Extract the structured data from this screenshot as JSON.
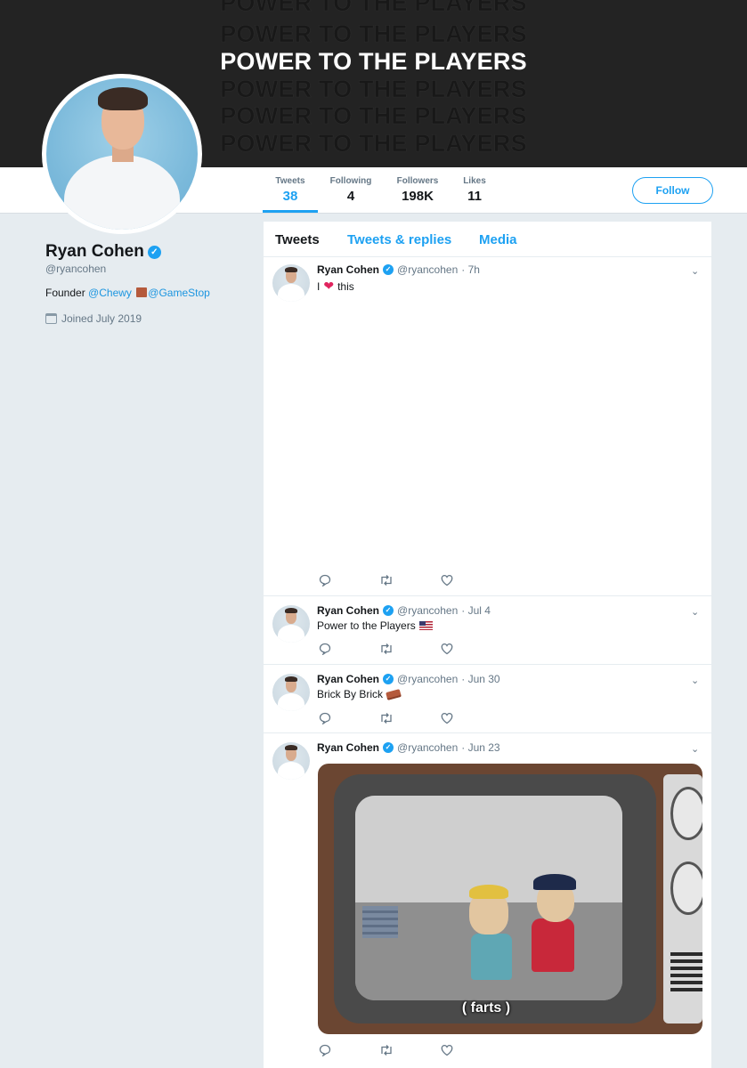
{
  "banner": {
    "lines": [
      "POWER TO THE PLAYERS",
      "POWER TO THE PLAYERS",
      "POWER TO THE PLAYERS",
      "POWER TO THE PLAYERS",
      "POWER TO THE PLAYERS",
      "POWER TO THE PLAYERS"
    ],
    "highlight_index": 2
  },
  "stats": [
    {
      "label": "Tweets",
      "value": "38"
    },
    {
      "label": "Following",
      "value": "4"
    },
    {
      "label": "Followers",
      "value": "198K"
    },
    {
      "label": "Likes",
      "value": "11"
    }
  ],
  "follow_label": "Follow",
  "profile": {
    "name": "Ryan Cohen",
    "handle": "@ryancohen",
    "bio_prefix": "Founder",
    "bio_link1": "@Chewy",
    "bio_link2": "@GameStop",
    "joined": "Joined July 2019"
  },
  "tabs": [
    "Tweets",
    "Tweets & replies",
    "Media"
  ],
  "tweets": [
    {
      "name": "Ryan Cohen",
      "handle": "@ryancohen",
      "time": "· 7h",
      "text_a": "I",
      "text_b": "this",
      "emoji": "heart"
    },
    {
      "name": "Ryan Cohen",
      "handle": "@ryancohen",
      "time": "· Jul 4",
      "text_a": "Power to the Players",
      "emoji": "us-flag"
    },
    {
      "name": "Ryan Cohen",
      "handle": "@ryancohen",
      "time": "· Jun 30",
      "text_a": "Brick By Brick",
      "emoji": "brick"
    },
    {
      "name": "Ryan Cohen",
      "handle": "@ryancohen",
      "time": "· Jun 23",
      "media_caption": "( farts )"
    }
  ],
  "colors": {
    "accent": "#1da1f2",
    "banner_bg": "#232323",
    "page_bg": "#e6ecf0"
  }
}
